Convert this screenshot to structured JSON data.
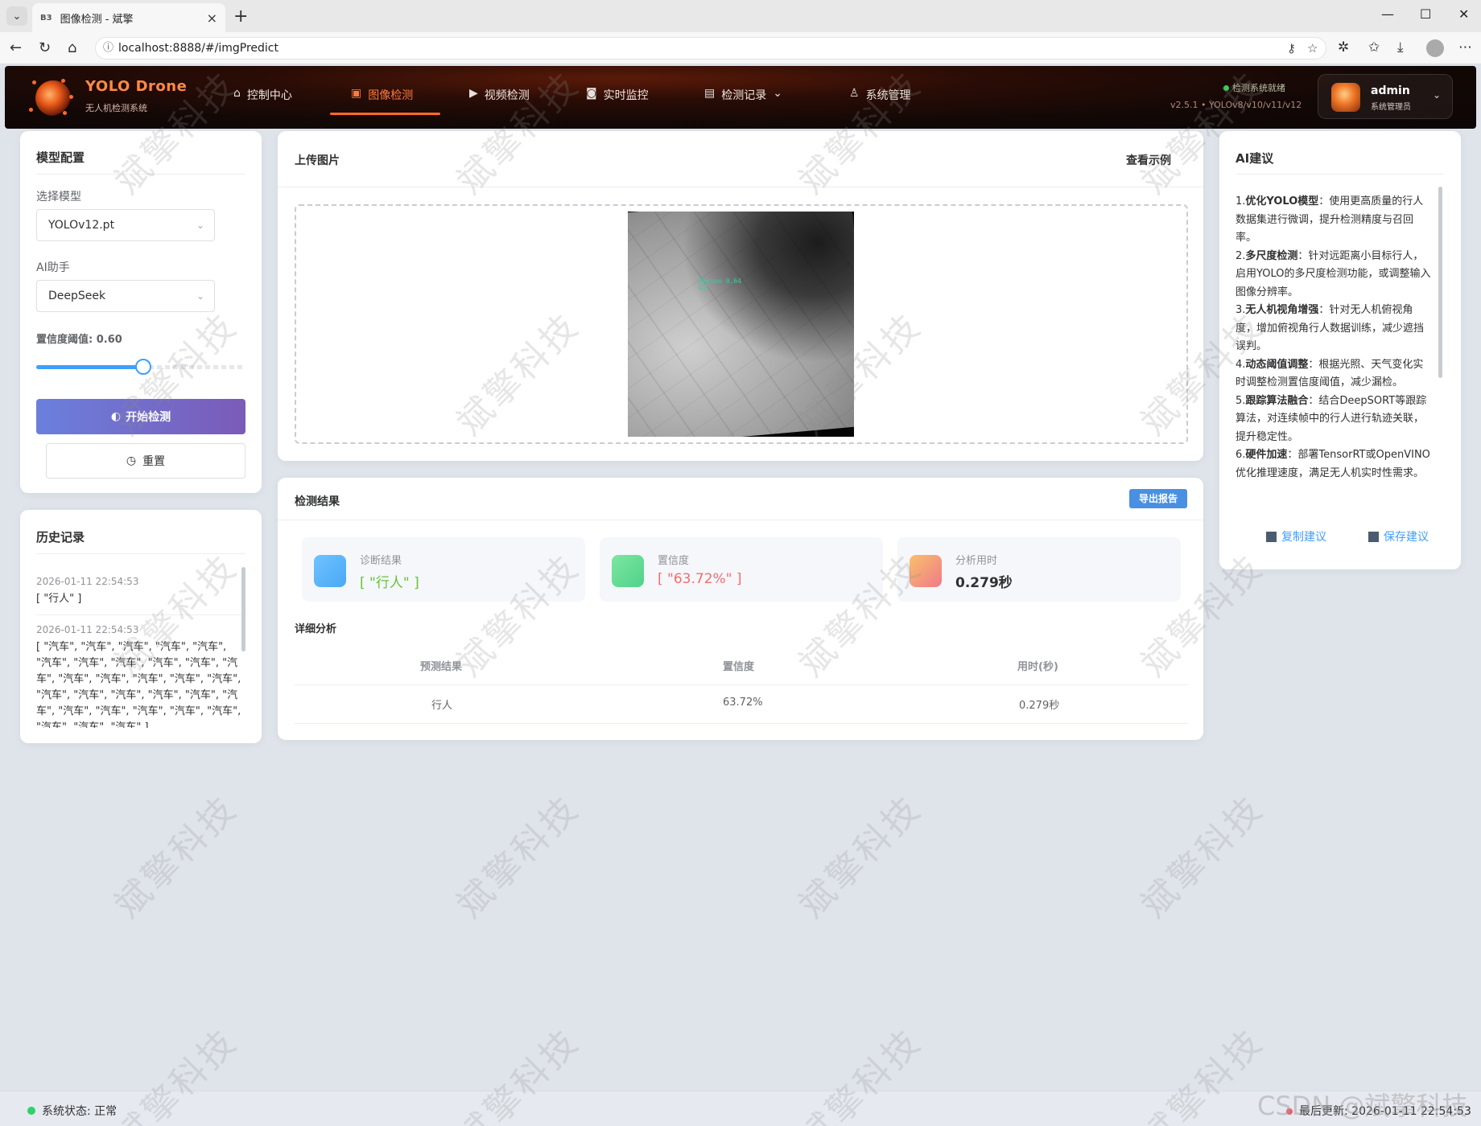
{
  "browser": {
    "tab_title": "图像检测 - 斌擎",
    "tab_favicon": "B3",
    "url": "localhost:8888/#/imgPredict"
  },
  "header": {
    "brand_title": "YOLO Drone",
    "brand_subtitle": "无人机检测系统",
    "nav": [
      {
        "label": "控制中心",
        "icon": "home-icon"
      },
      {
        "label": "图像检测",
        "icon": "image-icon",
        "active": true
      },
      {
        "label": "视频检测",
        "icon": "play-circle-icon"
      },
      {
        "label": "实时监控",
        "icon": "camera-icon"
      },
      {
        "label": "检测记录",
        "icon": "document-icon",
        "dropdown": true
      },
      {
        "label": "系统管理",
        "icon": "user-icon"
      }
    ],
    "status": "检测系统就绪",
    "version": "v2.5.1 • YOLOv8/v10/v11/v12",
    "user_name": "admin",
    "user_role": "系统管理员"
  },
  "model_config": {
    "title": "模型配置",
    "model_label": "选择模型",
    "model_value": "YOLOv12.pt",
    "ai_label": "AI助手",
    "ai_value": "DeepSeek",
    "threshold_label": "置信度阈值: 0.60",
    "threshold_value": 0.6,
    "start_button": "开始检测",
    "reset_button": "重置"
  },
  "history": {
    "title": "历史记录",
    "items": [
      {
        "time": "2026-01-11 22:54:53",
        "value": "[ \"行人\" ]"
      },
      {
        "time": "2026-01-11 22:54:53",
        "value": "[ \"汽车\", \"汽车\", \"汽车\", \"汽车\", \"汽车\", \"汽车\", \"汽车\", \"汽车\", \"汽车\", \"汽车\", \"汽车\", \"汽车\", \"汽车\", \"汽车\", \"汽车\", \"汽车\", \"汽车\", \"汽车\", \"汽车\", \"汽车\", \"汽车\", \"汽车\", \"汽车\", \"汽车\", \"汽车\", \"汽车\", \"汽车\", \"汽车\", \"汽车\", \"汽车\" ]"
      }
    ]
  },
  "upload": {
    "title": "上传图片",
    "example_link": "查看示例",
    "detection_label": "Person 0.64"
  },
  "results": {
    "title": "检测结果",
    "export_button": "导出报告",
    "stats": [
      {
        "label": "诊断结果",
        "value": "[ \"行人\" ]",
        "color": "#67c23a",
        "icon_gradient": [
          "#6fc3ff",
          "#4aa8f5"
        ]
      },
      {
        "label": "置信度",
        "value": "[ \"63.72%\" ]",
        "color": "#f56c6c",
        "icon_gradient": [
          "#7ee6a0",
          "#4fd28a"
        ]
      },
      {
        "label": "分析用时",
        "value": "0.279秒",
        "color": "#303133",
        "icon_gradient": [
          "#f9c06a",
          "#f07a8a"
        ]
      }
    ],
    "detail_title": "详细分析",
    "table": {
      "headers": [
        "预测结果",
        "置信度",
        "用时(秒)"
      ],
      "rows": [
        [
          "行人",
          "63.72%",
          "0.279秒"
        ]
      ]
    }
  },
  "ai": {
    "title": "AI建议",
    "items": [
      {
        "num": "1.",
        "head": "优化YOLO模型",
        "body": "：使用更高质量的行人数据集进行微调，提升检测精度与召回率。"
      },
      {
        "num": "2.",
        "head": "多尺度检测",
        "body": "：针对远距离小目标行人，启用YOLO的多尺度检测功能，或调整输入图像分辨率。"
      },
      {
        "num": "3.",
        "head": "无人机视角增强",
        "body": "：针对无人机俯视角度，增加俯视角行人数据训练，减少遮挡误判。"
      },
      {
        "num": "4.",
        "head": "动态阈值调整",
        "body": "：根据光照、天气变化实时调整检测置信度阈值，减少漏检。"
      },
      {
        "num": "5.",
        "head": "跟踪算法融合",
        "body": "：结合DeepSORT等跟踪算法，对连续帧中的行人进行轨迹关联，提升稳定性。"
      },
      {
        "num": "6.",
        "head": "硬件加速",
        "body": "：部署TensorRT或OpenVINO优化推理速度，满足无人机实时性需求。"
      }
    ],
    "copy_button": "复制建议",
    "save_button": "保存建议"
  },
  "statusbar": {
    "status": "系统状态: 正常",
    "last_update": "最后更新: 2026-01-11 22:54:53"
  },
  "watermark": "斌擎科技",
  "corner_watermark": "CSDN @斌擎科技"
}
